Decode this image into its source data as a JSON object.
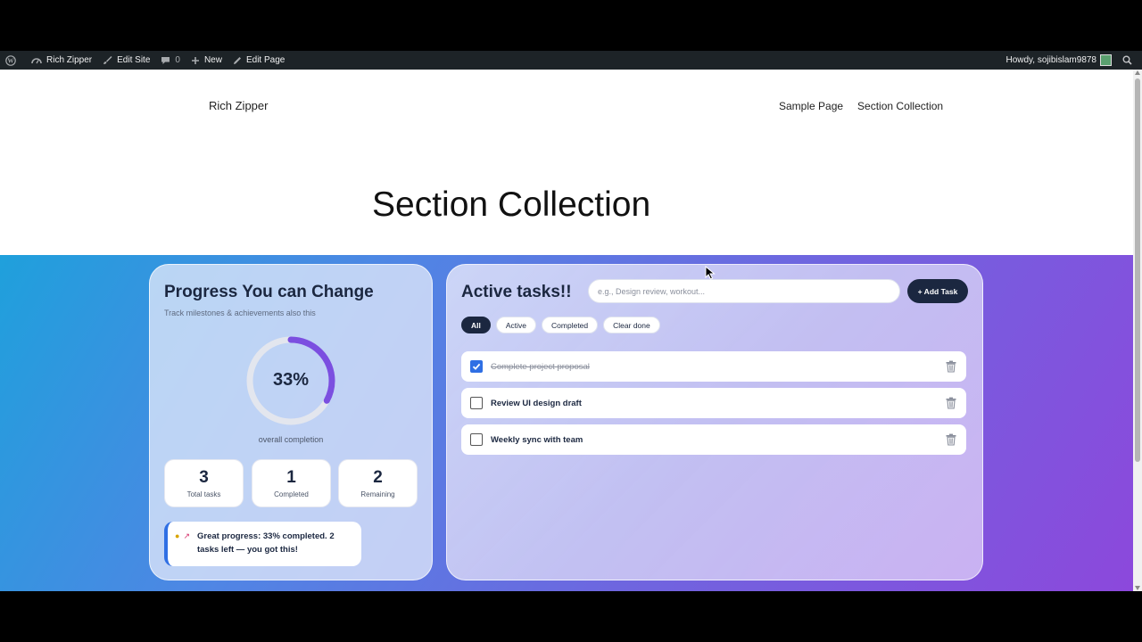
{
  "adminbar": {
    "site_name": "Rich Zipper",
    "edit_site": "Edit Site",
    "comments_count": "0",
    "new_label": "New",
    "edit_page": "Edit Page",
    "howdy": "Howdy, sojibislam9878"
  },
  "header": {
    "site_title": "Rich Zipper",
    "nav": [
      "Sample Page",
      "Section Collection"
    ]
  },
  "page_title": "Section Collection",
  "progress": {
    "title": "Progress You can Change",
    "subtitle": "Track milestones & achievements also this",
    "percent_label": "33%",
    "percent_value": 0.33,
    "overall_label": "overall completion",
    "stats": [
      {
        "value": "3",
        "label": "Total tasks"
      },
      {
        "value": "1",
        "label": "Completed"
      },
      {
        "value": "2",
        "label": "Remaining"
      }
    ],
    "tip_text": "Great progress: 33% completed. 2 tasks left — you got this!",
    "colors": {
      "ring": "#7b4fe0",
      "ring_track": "#e3e6ee"
    }
  },
  "tasks": {
    "title": "Active tasks!!",
    "input_placeholder": "e.g., Design review, workout...",
    "add_button": "+ Add Task",
    "filters": [
      "All",
      "Active",
      "Completed",
      "Clear done"
    ],
    "active_filter": "All",
    "items": [
      {
        "label": "Complete project proposal",
        "done": true
      },
      {
        "label": "Review UI design draft",
        "done": false
      },
      {
        "label": "Weekly sync with team",
        "done": false
      }
    ]
  }
}
